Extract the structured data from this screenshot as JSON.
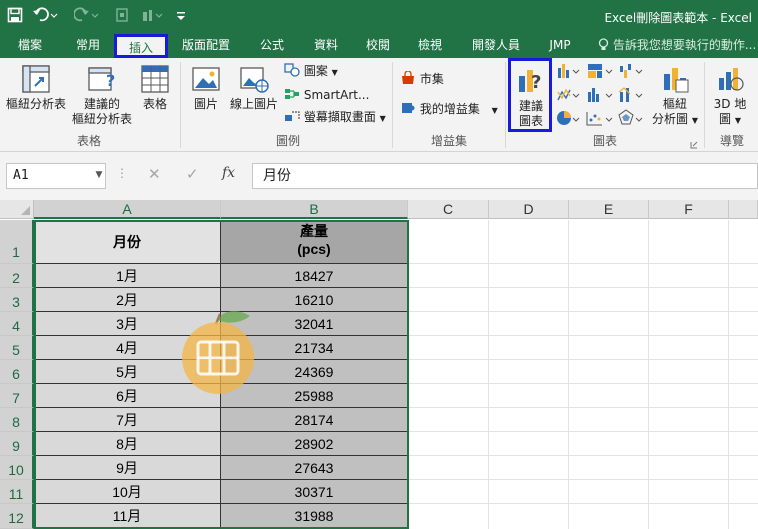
{
  "window": {
    "title": "Excel刪除圖表範本 - Excel"
  },
  "qat": {
    "icons": [
      "save-icon",
      "undo-icon",
      "redo-icon",
      "touch-mode-icon",
      "customize-icon"
    ]
  },
  "tabs": [
    {
      "label": "檔案"
    },
    {
      "label": "常用"
    },
    {
      "label": "插入"
    },
    {
      "label": "版面配置"
    },
    {
      "label": "公式"
    },
    {
      "label": "資料"
    },
    {
      "label": "校閱"
    },
    {
      "label": "檢視"
    },
    {
      "label": "開發人員"
    },
    {
      "label": "JMP"
    }
  ],
  "active_tab": "插入",
  "tell_me": "告訴我您想要執行的動作...",
  "ribbon": {
    "tables": {
      "group": "表格",
      "pivot": "樞紐分析表",
      "recommended_pivot_1": "建議的",
      "recommended_pivot_2": "樞紐分析表",
      "table": "表格"
    },
    "illustrations": {
      "group": "圖例",
      "pictures": "圖片",
      "online_pictures": "線上圖片",
      "shapes": "圖案",
      "smartart": "SmartArt...",
      "screenshot": "螢幕擷取畫面"
    },
    "addins": {
      "group": "增益集",
      "store": "市集",
      "my_addins": "我的增益集"
    },
    "charts": {
      "group": "圖表",
      "recommended_1": "建議",
      "recommended_2": "圖表",
      "pivot_chart_1": "樞紐",
      "pivot_chart_2": "分析圖"
    },
    "tours": {
      "group": "導覽",
      "map_1": "3D 地",
      "map_2": "圖"
    }
  },
  "formula_bar": {
    "name_box": "A1",
    "fx": "fx",
    "value": "月份"
  },
  "columns": [
    "A",
    "B",
    "C",
    "D",
    "E",
    "F"
  ],
  "rows": [
    "1",
    "2",
    "3",
    "4",
    "5",
    "6",
    "7",
    "8",
    "9",
    "10",
    "11",
    "12"
  ],
  "sheet": {
    "header_month": "月份",
    "header_output_1": "產量",
    "header_output_2": "(pcs)",
    "data": [
      {
        "month": "1月",
        "value": "18427"
      },
      {
        "month": "2月",
        "value": "16210"
      },
      {
        "month": "3月",
        "value": "32041"
      },
      {
        "month": "4月",
        "value": "21734"
      },
      {
        "month": "5月",
        "value": "24369"
      },
      {
        "month": "6月",
        "value": "25988"
      },
      {
        "month": "7月",
        "value": "28174"
      },
      {
        "month": "8月",
        "value": "28902"
      },
      {
        "month": "9月",
        "value": "27643"
      },
      {
        "month": "10月",
        "value": "30371"
      },
      {
        "month": "11月",
        "value": "31988"
      }
    ]
  },
  "colors": {
    "excel_green": "#217346",
    "highlight_blue": "#1a1adc",
    "header_gray": "#a6a6a6",
    "cell_gray": "#d9d9d9",
    "watermark_orange": "#f3b545"
  }
}
